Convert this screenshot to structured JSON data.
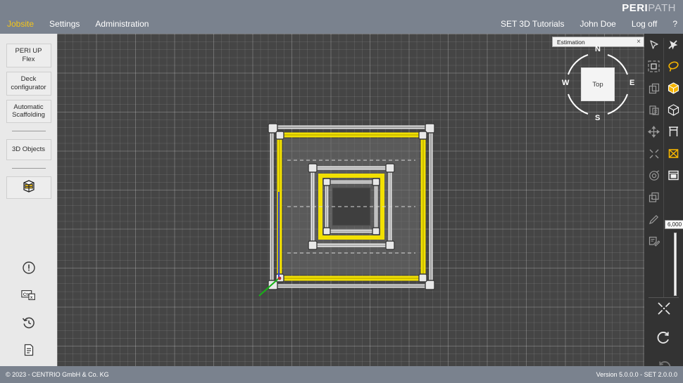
{
  "header": {
    "logo_peri": "PERI",
    "logo_path": "PATH",
    "nav_left": [
      {
        "label": "Jobsite",
        "active": true,
        "name": "nav-jobsite"
      },
      {
        "label": "Settings",
        "active": false,
        "name": "nav-settings"
      },
      {
        "label": "Administration",
        "active": false,
        "name": "nav-administration"
      }
    ],
    "nav_right": [
      {
        "label": "SET 3D Tutorials",
        "name": "nav-set-3d-tutorials"
      },
      {
        "label": "John Doe",
        "name": "nav-user-john-doe"
      },
      {
        "label": "Log off",
        "name": "nav-log-off"
      },
      {
        "label": "?",
        "name": "nav-help"
      }
    ],
    "accent_color": "#f5c518",
    "bar_color": "#7a828e"
  },
  "sidebar": {
    "buttons": [
      {
        "label": "PERI UP Flex",
        "name": "sidebar-peri-up-flex"
      },
      {
        "label": "Deck configurator",
        "name": "sidebar-deck-configurator"
      },
      {
        "label": "Automatic Scaffolding",
        "name": "sidebar-automatic-scaffolding"
      }
    ],
    "buttons2": [
      {
        "label": "3D Objects",
        "name": "sidebar-3d-objects"
      }
    ],
    "icon_button": {
      "icon": "3d-box-icon",
      "name": "sidebar-3d-box-button"
    },
    "tool_icons": [
      {
        "icon": "info-circle-icon",
        "name": "sidebar-info-icon"
      },
      {
        "icon": "ctrl-x-shortcut-icon",
        "name": "sidebar-shortcuts-icon"
      },
      {
        "icon": "history-clock-icon",
        "name": "sidebar-history-icon"
      },
      {
        "icon": "document-icon",
        "name": "sidebar-document-icon"
      },
      {
        "icon": "gear-icon",
        "name": "sidebar-settings-icon"
      }
    ]
  },
  "viewport": {
    "background_color": "#454545",
    "estimation_panel": {
      "title": "Estimation",
      "close": "×"
    },
    "compass": {
      "north": "N",
      "east": "E",
      "south": "S",
      "west": "W",
      "face_label": "Top"
    },
    "model": {
      "name": "scaffolding-top-view",
      "rail_color": "#f2e000",
      "post_color": "#e2e2e2"
    }
  },
  "right_toolbar": {
    "rows": [
      [
        {
          "icon": "cursor-select-icon",
          "name": "tool-select",
          "active": false
        },
        {
          "icon": "cursor-disabled-icon",
          "name": "tool-deselect",
          "active": false
        }
      ],
      [
        {
          "icon": "select-box-icon",
          "name": "tool-box-select",
          "active": false
        },
        {
          "icon": "lasso-rotate-icon",
          "name": "tool-lasso-select",
          "active": true
        }
      ],
      [
        {
          "icon": "copy-icon",
          "name": "tool-copy",
          "active": false
        },
        {
          "icon": "cube-solid-icon",
          "name": "tool-cube-solid",
          "active": true
        }
      ],
      [
        {
          "icon": "paste-icon",
          "name": "tool-paste",
          "active": false
        },
        {
          "icon": "cube-wire-icon",
          "name": "tool-cube-wire",
          "active": false
        }
      ],
      [
        {
          "icon": "move-icon",
          "name": "tool-move",
          "active": false
        },
        {
          "icon": "frame-h-icon",
          "name": "tool-frame",
          "active": false
        }
      ],
      [
        {
          "icon": "collapse-icon",
          "name": "tool-collapse",
          "active": false
        },
        {
          "icon": "brace-x-icon",
          "name": "tool-brace",
          "active": true
        }
      ],
      [
        {
          "icon": "target-icon",
          "name": "tool-target",
          "active": false
        },
        {
          "icon": "scaffold-unit-icon",
          "name": "tool-scaffold-unit",
          "active": false
        }
      ],
      [
        {
          "icon": "duplicate-add-icon",
          "name": "tool-duplicate-add",
          "active": false
        },
        {
          "icon": "",
          "name": "tool-empty-1",
          "active": false
        }
      ],
      [
        {
          "icon": "pencil-icon",
          "name": "tool-edit",
          "active": false
        },
        {
          "icon": "",
          "name": "tool-empty-2",
          "active": false
        }
      ],
      [
        {
          "icon": "annotate-icon",
          "name": "tool-annotate",
          "active": false
        },
        {
          "icon": "",
          "name": "tool-empty-3",
          "active": false
        }
      ]
    ],
    "slider": {
      "value": "6,000",
      "name": "height-slider"
    },
    "bottom": [
      {
        "icon": "zoom-fit-icon",
        "name": "tool-zoom-fit"
      },
      {
        "icon": "undo-icon",
        "name": "tool-undo"
      },
      {
        "icon": "redo-icon",
        "name": "tool-redo"
      }
    ]
  },
  "footer": {
    "copyright": "© 2023 - CENTRIO GmbH & Co. KG",
    "version": "Version 5.0.0.0 - SET 2.0.0.0"
  }
}
